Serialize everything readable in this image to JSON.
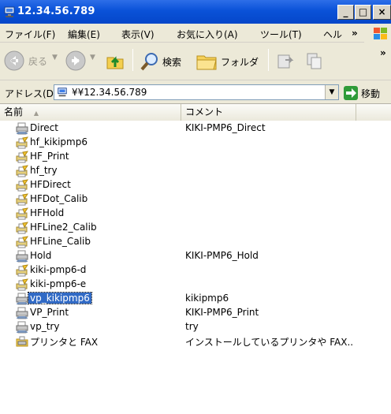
{
  "window": {
    "title": "12.34.56.789",
    "minimize_glyph": "_",
    "maximize_glyph": "□",
    "close_glyph": "×"
  },
  "menu": {
    "items": [
      "ファイル(F)",
      "編集(E)",
      "表示(V)",
      "お気に入り(A)",
      "ツール(T)",
      "ヘル"
    ],
    "overflow": "»"
  },
  "toolbar": {
    "back_label": "戻る",
    "search_label": "検索",
    "folders_label": "フォルダ",
    "overflow": "»"
  },
  "address": {
    "label": "アドレス(D)",
    "value": "¥¥12.34.56.789",
    "go_label": "移動"
  },
  "list": {
    "columns": [
      "名前",
      "コメント"
    ],
    "sort_indicator": "▲",
    "items": [
      {
        "name": "Direct",
        "comment": "KIKI-PMP6_Direct",
        "icon": "printer-icon",
        "selected": false
      },
      {
        "name": "hf_kikipmp6",
        "comment": "",
        "icon": "fax-printer-icon",
        "selected": false
      },
      {
        "name": "HF_Print",
        "comment": "",
        "icon": "fax-printer-icon",
        "selected": false
      },
      {
        "name": "hf_try",
        "comment": "",
        "icon": "fax-printer-icon",
        "selected": false
      },
      {
        "name": "HFDirect",
        "comment": "",
        "icon": "fax-printer-icon",
        "selected": false
      },
      {
        "name": "HFDot_Calib",
        "comment": "",
        "icon": "fax-printer-icon",
        "selected": false
      },
      {
        "name": "HFHold",
        "comment": "",
        "icon": "fax-printer-icon",
        "selected": false
      },
      {
        "name": "HFLine2_Calib",
        "comment": "",
        "icon": "fax-printer-icon",
        "selected": false
      },
      {
        "name": "HFLine_Calib",
        "comment": "",
        "icon": "fax-printer-icon",
        "selected": false
      },
      {
        "name": "Hold",
        "comment": "KIKI-PMP6_Hold",
        "icon": "printer-icon",
        "selected": false
      },
      {
        "name": "kiki-pmp6-d",
        "comment": "",
        "icon": "fax-printer-icon",
        "selected": false
      },
      {
        "name": "kiki-pmp6-e",
        "comment": "",
        "icon": "fax-printer-icon",
        "selected": false
      },
      {
        "name": "vp_kikipmp6",
        "comment": "kikipmp6",
        "icon": "printer-icon",
        "selected": true
      },
      {
        "name": "VP_Print",
        "comment": "KIKI-PMP6_Print",
        "icon": "printer-icon",
        "selected": false
      },
      {
        "name": "vp_try",
        "comment": "try",
        "icon": "printer-icon",
        "selected": false
      },
      {
        "name": "プリンタと FAX",
        "comment": "インストールしているプリンタや FAX..",
        "icon": "printers-folder-icon",
        "selected": false
      }
    ]
  },
  "colors": {
    "titlebar": "#0a52d8",
    "chrome": "#ece9d8",
    "selection": "#316ac5",
    "go_green": "#2f9b38"
  }
}
